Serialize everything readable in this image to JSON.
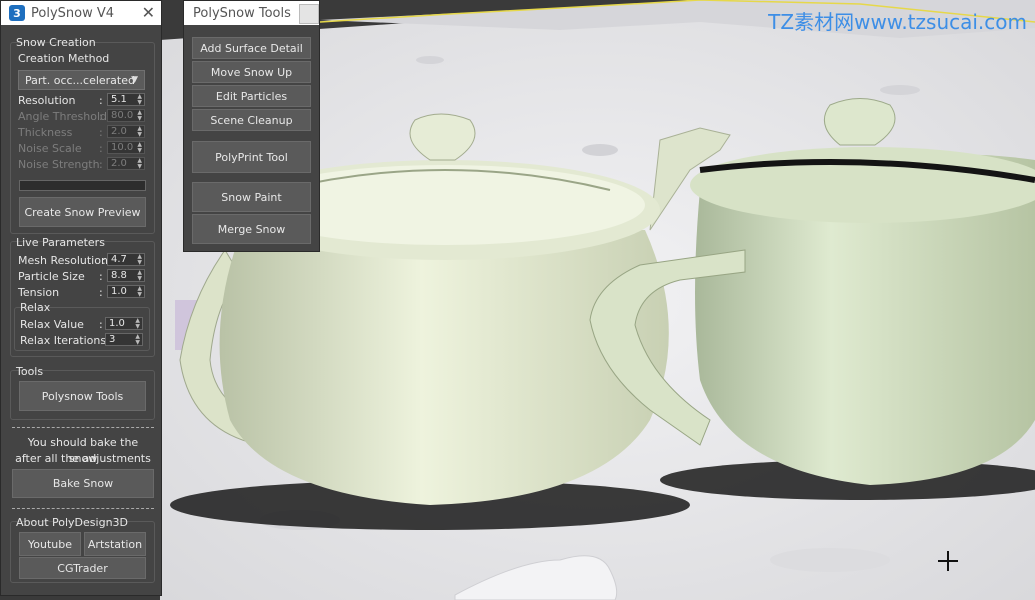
{
  "watermark": "TZ素材网www.tzsucai.com",
  "polysnow": {
    "title": "PolySnow V4",
    "logo": "3",
    "snow_creation": {
      "group_label": "Snow Creation",
      "method_label": "Creation Method",
      "method_value": "Part. occ...celerated",
      "params": [
        {
          "label": "Resolution",
          "value": "5.1",
          "enabled": true
        },
        {
          "label": "Angle Threshold",
          "value": "80.0",
          "enabled": false
        },
        {
          "label": "Thickness",
          "value": "2.0",
          "enabled": false
        },
        {
          "label": "Noise Scale",
          "value": "10.0",
          "enabled": false
        },
        {
          "label": "Noise Strength",
          "value": "2.0",
          "enabled": false
        }
      ],
      "preview_button": "Create Snow Preview"
    },
    "live": {
      "group_label": "Live Parameters",
      "params": [
        {
          "label": "Mesh Resolution",
          "value": "4.7"
        },
        {
          "label": "Particle Size",
          "value": "8.8"
        },
        {
          "label": "Tension",
          "value": "1.0"
        }
      ],
      "relax_label": "Relax",
      "relax_params": [
        {
          "label": "Relax Value",
          "value": "1.0"
        },
        {
          "label": "Relax Iterations",
          "value": "3"
        }
      ]
    },
    "tools": {
      "group_label": "Tools",
      "button": "Polysnow Tools"
    },
    "bake_note_1": "You should bake the snow",
    "bake_note_2": "after all the adjustments",
    "bake_button": "Bake Snow",
    "about": {
      "group_label": "About PolyDesign3D",
      "youtube": "Youtube",
      "artstation": "Artstation",
      "cgtrader": "CGTrader"
    }
  },
  "tools_panel": {
    "title": "PolySnow Tools",
    "buttons": [
      "Add Surface Detail",
      "Move Snow Up",
      "Edit Particles",
      "Scene Cleanup",
      "PolyPrint Tool",
      "Snow Paint",
      "Merge Snow"
    ]
  },
  "colors": {
    "panel_bg": "#444444",
    "teapot": "#dfe6cc",
    "snow": "#ececee",
    "watermark": "#3d8ee6"
  }
}
